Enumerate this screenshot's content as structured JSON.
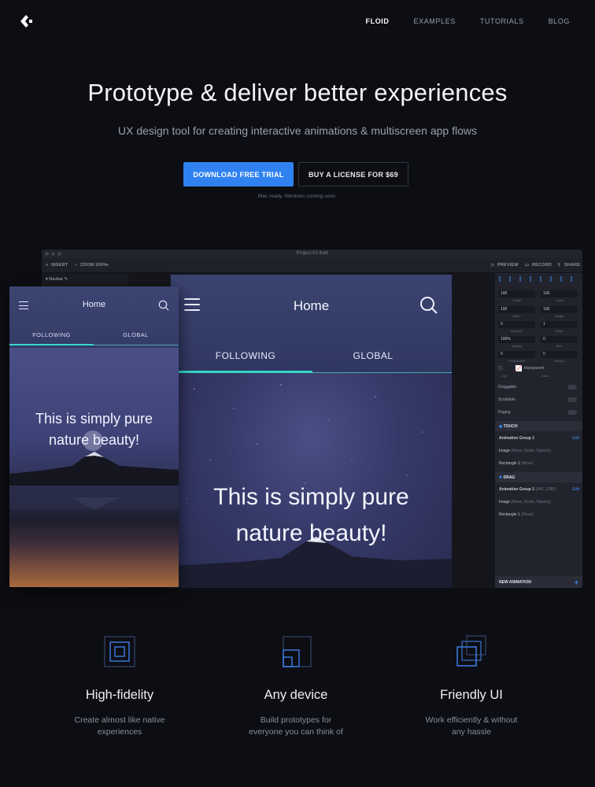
{
  "nav": {
    "links": [
      "FLOID",
      "EXAMPLES",
      "TUTORIALS",
      "BLOG"
    ],
    "active_index": 0
  },
  "hero": {
    "title": "Prototype & deliver better experiences",
    "subtitle": "UX design tool for creating interactive animations & multiscreen app flows",
    "primary_button": "DOWNLOAD FREE TRIAL",
    "secondary_button": "BUY A LICENSE FOR $69",
    "note": "Mac ready. Windows coming soon."
  },
  "app": {
    "window_title": "Project-01.floid",
    "toolbar": {
      "insert": "INSERT",
      "zoom": "ZOOM 100%",
      "preview": "PREVIEW",
      "record": "RECORD",
      "share": "SHARE"
    },
    "layers": {
      "navbar": "Navbar"
    },
    "phone": {
      "title": "Home",
      "tabs": [
        "FOLLOWING",
        "GLOBAL"
      ],
      "caption_line1": "This is simply pure",
      "caption_line2": "nature beauty!"
    },
    "inspector": {
      "x_axis": "100",
      "y_axis": "100",
      "x_label": "X axis",
      "y_label": "Y axis",
      "width": "100",
      "height": "100",
      "width_label": "Width",
      "height_label": "Height",
      "rotation": "0",
      "scale": "1",
      "rotation_label": "Rotation",
      "scale_label": "Scale",
      "opacity": "100%",
      "blur": "0",
      "opacity_label": "Opacity",
      "blur_label": "Blur",
      "perspective": "0",
      "radius": "0",
      "perspective_label": "Perspective",
      "radius_label": "Radius",
      "fill_label": "transparent",
      "clip_label": "Clip",
      "color_label": "Color",
      "draggable": "Draggable",
      "scrollable": "Scrollable",
      "paging": "Paging",
      "touch_section": "TOUCH",
      "drag_section": "DRAG",
      "touch_group": "Animation Group 1",
      "touch_image": "Image",
      "touch_image_detail": "(Move, Scale, Opacity)",
      "touch_rect": "Rectangle 1",
      "touch_rect_detail": "(Move)",
      "drag_group": "Animation Group 1",
      "drag_group_detail": "(640, 1280)",
      "drag_image": "Image",
      "drag_image_detail": "(Move, Scale, Opacity)",
      "drag_rect": "Rectangle 1",
      "drag_rect_detail": "(Move)",
      "edit": "Edit",
      "new_animation": "NEW ANIMATION"
    }
  },
  "features": [
    {
      "title": "High-fidelity",
      "desc_line1": "Create almost like native",
      "desc_line2": "experiences"
    },
    {
      "title": "Any device",
      "desc_line1": "Build prototypes for",
      "desc_line2": "everyone you can think of"
    },
    {
      "title": "Friendly UI",
      "desc_line1": "Work efficiently & without",
      "desc_line2": "any hassle"
    }
  ],
  "colors": {
    "background": "#0d0e13",
    "accent_blue": "#2f82f0",
    "accent_teal": "#35d6c6"
  }
}
